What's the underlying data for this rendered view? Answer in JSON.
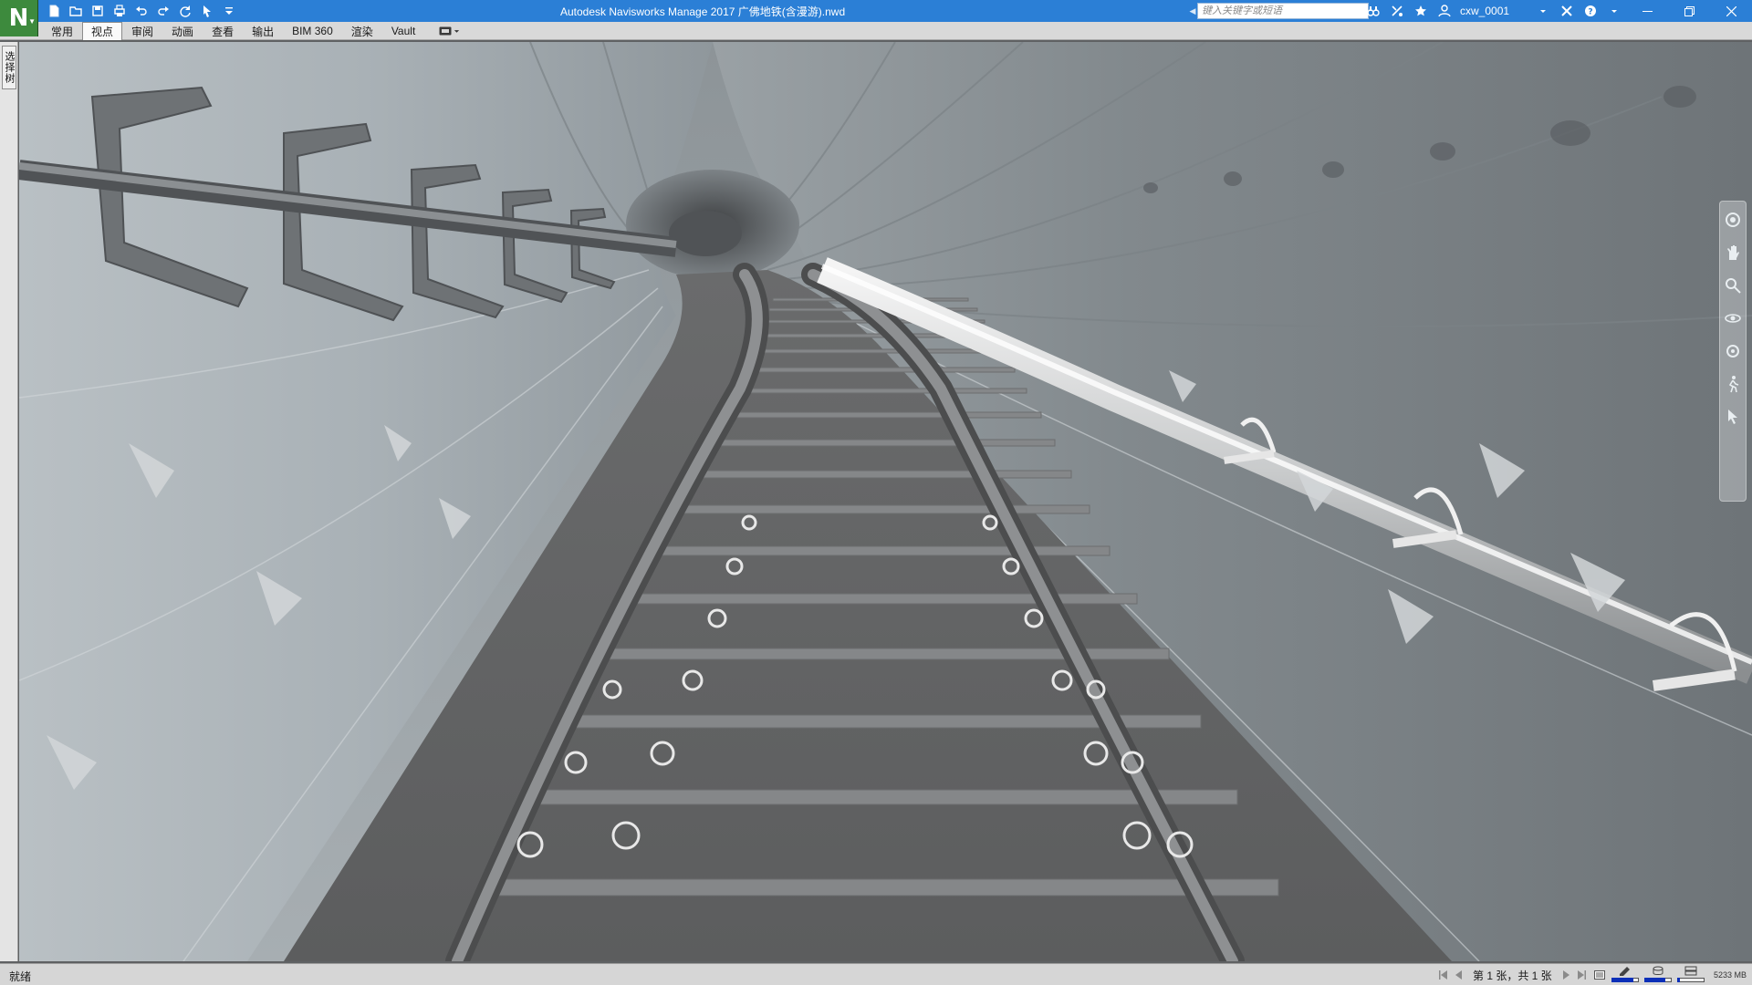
{
  "window": {
    "title": "Autodesk Navisworks Manage 2017    广佛地铁(含漫游).nwd",
    "app_letter": "N"
  },
  "quick_access": {
    "icons": [
      "new-file-icon",
      "open-folder-icon",
      "save-icon",
      "print-icon",
      "undo-icon",
      "redo-icon",
      "refresh-icon",
      "select-cursor-icon",
      "customize-dropdown-icon"
    ]
  },
  "search": {
    "placeholder": "键入关键字或短语"
  },
  "user": {
    "name": "cxw_0001"
  },
  "ribbon": {
    "tabs": [
      {
        "label": "常用",
        "active": false
      },
      {
        "label": "视点",
        "active": true
      },
      {
        "label": "审阅",
        "active": false
      },
      {
        "label": "动画",
        "active": false
      },
      {
        "label": "查看",
        "active": false
      },
      {
        "label": "输出",
        "active": false
      },
      {
        "label": "BIM 360",
        "active": false
      },
      {
        "label": "渲染",
        "active": false
      },
      {
        "label": "Vault",
        "active": false
      }
    ]
  },
  "left_dock": {
    "tree_tab_label": "选择树"
  },
  "navbar": {
    "icons": [
      "steering-wheel-icon",
      "pan-hand-icon",
      "zoom-icon",
      "orbit-icon",
      "look-around-icon",
      "walk-icon",
      "select-icon"
    ]
  },
  "status": {
    "text": "就绪",
    "page_info": "第 1 张，共 1 张",
    "memory": "5233 MB",
    "pencil_progress": 0.8,
    "disk_progress": 0.75,
    "web_server_progress": 0.1
  },
  "colors": {
    "title_bar": "#2b7fd6",
    "app_button": "#3d8a3d",
    "ribbon": "#d9d9d9",
    "status_bar": "#d6d6d6",
    "progress_blue": "#0b2fb8"
  }
}
